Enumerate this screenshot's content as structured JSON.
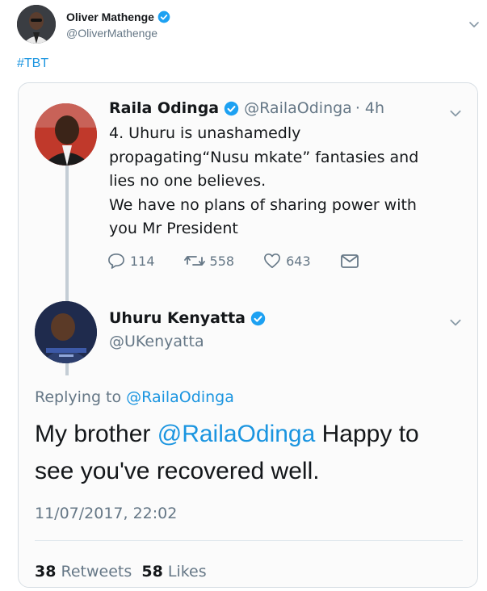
{
  "outer_tweet": {
    "author_name": "Oliver Mathenge",
    "author_handle": "@OliverMathenge",
    "text": "#TBT"
  },
  "quoted": {
    "tweet1": {
      "author_name": "Raila Odinga",
      "author_handle": "@RailaOdinga",
      "time": "· 4h",
      "lines": [
        "4. Uhuru is unashamedly",
        "propagating“Nusu mkate” fantasies and",
        "lies no one believes.",
        "We have no plans of sharing power with",
        "you Mr President"
      ],
      "replies": "114",
      "retweets": "558",
      "likes": "643"
    },
    "tweet2": {
      "author_name": "Uhuru Kenyatta",
      "author_handle": "@UKenyatta",
      "replying_prefix": "Replying to",
      "replying_to": "@RailaOdinga",
      "text_before": "My brother",
      "mention": "@RailaOdinga",
      "text_after": "Happy to see you've recovered well.",
      "timestamp": "11/07/2017, 22:02",
      "retweets_count": "38",
      "retweets_label": "Retweets",
      "likes_count": "58",
      "likes_label": "Likes"
    }
  },
  "colors": {
    "link": "#1b95e0",
    "secondary_text": "#657786",
    "verified": "#1da1f2"
  }
}
